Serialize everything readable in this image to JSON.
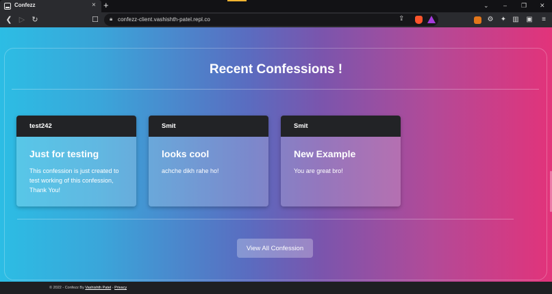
{
  "browser": {
    "tab_title": "Confezz",
    "tab_close": "×",
    "new_tab": "+",
    "url": "confezz-client.vashishth-patel.repl.co",
    "window_controls": {
      "dropdown": "⌄",
      "minimize": "–",
      "restore": "❐",
      "close": "✕"
    },
    "icons": [
      "back-icon",
      "forward-icon",
      "reload-icon",
      "bookmark-icon",
      "lock-icon",
      "share-icon",
      "brave-shields-icon",
      "brave-rewards-icon",
      "metamask-icon",
      "extension-icon",
      "puzzle-icon",
      "sidebar-icon",
      "wallet-icon",
      "menu-icon"
    ]
  },
  "page": {
    "title": "Recent Confessions !",
    "gradient": [
      "#2cbde4",
      "#5a6cc0",
      "#e2337a"
    ]
  },
  "confessions": [
    {
      "author": "test242",
      "title": "Just for testing",
      "body": "This confession is just created to test working of this confession, Thank You!"
    },
    {
      "author": "Smit",
      "title": "looks cool",
      "body": "achche dikh rahe ho!"
    },
    {
      "author": "Smit",
      "title": "New Example",
      "body": "You are great bro!"
    }
  ],
  "view_all_label": "View All Confession",
  "footer": {
    "prefix": "© 2022 - Confezz By ",
    "author": "Vashishth Patel",
    "separator": " - ",
    "privacy": "Privacy"
  }
}
